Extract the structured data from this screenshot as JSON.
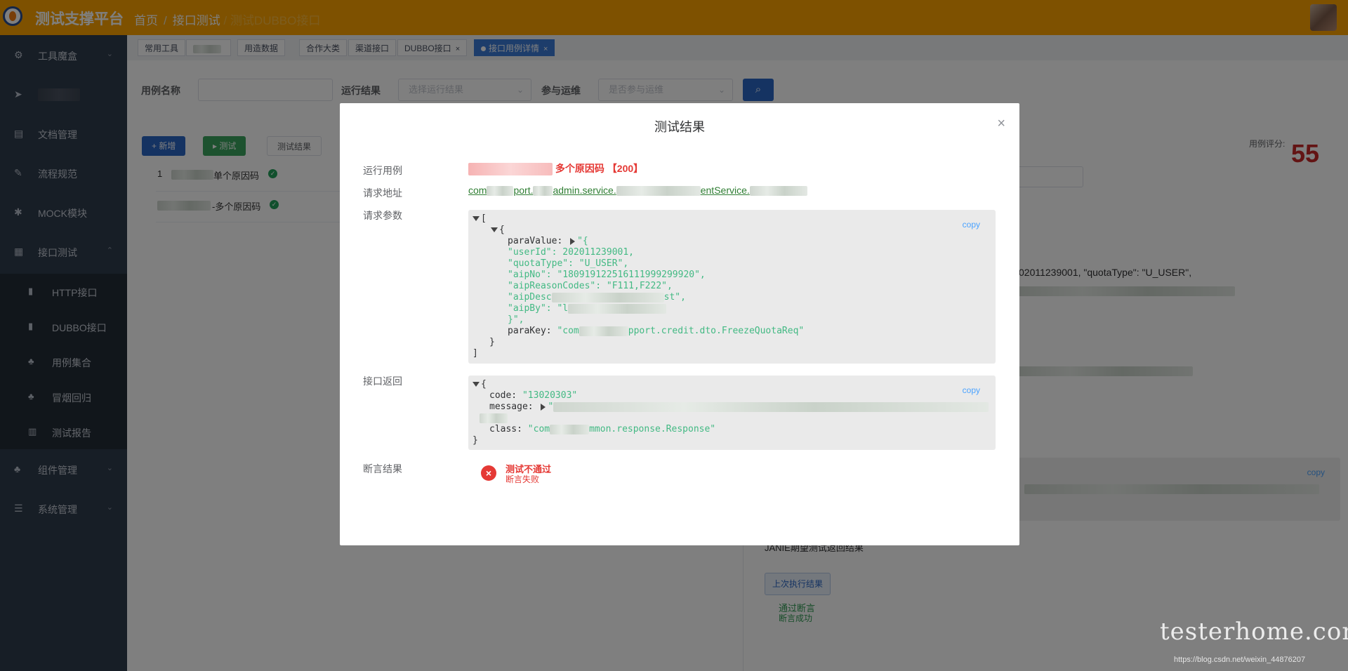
{
  "app": {
    "title": "测试支撑平台"
  },
  "breadcrumb": {
    "home": "首页",
    "section": "接口测试",
    "current": "/ 测试DUBBO接口"
  },
  "sidebar": {
    "items": [
      {
        "label": "工具魔盒",
        "icon": "gear-icon",
        "arrow": "⌄"
      },
      {
        "label": "",
        "icon": "send-icon",
        "arrow": ""
      },
      {
        "label": "文档管理",
        "icon": "document-icon",
        "arrow": ""
      },
      {
        "label": "流程规范",
        "icon": "edit-icon",
        "arrow": ""
      },
      {
        "label": "MOCK模块",
        "icon": "bug-icon",
        "arrow": ""
      },
      {
        "label": "接口测试",
        "icon": "grid-icon",
        "arrow": "⌃"
      }
    ],
    "sub_items": [
      {
        "label": "HTTP接口",
        "icon": "doc-icon"
      },
      {
        "label": "DUBBO接口",
        "icon": "doc-icon"
      },
      {
        "label": "用例集合",
        "icon": "sitemap-icon"
      },
      {
        "label": "冒烟回归",
        "icon": "sitemap-icon"
      },
      {
        "label": "测试报告",
        "icon": "bar-chart-icon"
      }
    ],
    "bottom_items": [
      {
        "label": "组件管理",
        "icon": "sitemap-icon",
        "arrow": "⌄"
      },
      {
        "label": "系统管理",
        "icon": "list-icon",
        "arrow": "⌄"
      }
    ]
  },
  "tabs": [
    {
      "label": "常用工具"
    },
    {
      "label": ""
    },
    {
      "label": "用造数据"
    },
    {
      "label": "合作大类"
    },
    {
      "label": "渠道接口"
    },
    {
      "label": "DUBBO接口",
      "close": "×"
    },
    {
      "label": "接口用例详情",
      "close": "×"
    }
  ],
  "filters": {
    "case_name_label": "用例名称",
    "run_result_label": "运行结果",
    "run_result_placeholder": "选择运行结果",
    "ops_label": "参与运维",
    "ops_placeholder": "是否参与运维"
  },
  "actions": {
    "add": "+ 新增",
    "test": "▸ 测试",
    "result": "测试结果"
  },
  "list": [
    {
      "index": "1",
      "name": "单个原因码"
    },
    {
      "index": "",
      "name": "-多个原因码"
    }
  ],
  "right_panel": {
    "score_label": "用例评分:",
    "score_value": "55",
    "param_snippet": "02011239001, \"quotaType\": \"U_USER\",",
    "copy": "copy",
    "expect_label": "JANIE期望测试返回结果",
    "last_run_btn": "上次执行结果",
    "pass_title": "通过断言",
    "pass_sub": "断言成功"
  },
  "modal": {
    "title": "测试结果",
    "close": "×",
    "run_case_label": "运行用例",
    "run_case_value": "多个原因码 【200】",
    "request_url_label": "请求地址",
    "request_url_a": "com",
    "request_url_b": "port.",
    "request_url_c": "admin.service.",
    "request_url_d": "entService.",
    "request_params_label": "请求参数",
    "response_label": "接口返回",
    "assert_label": "断言结果",
    "assert_title": "测试不通过",
    "assert_sub": "断言失败",
    "copy": "copy",
    "params_lines": {
      "l0": "[",
      "l1": "{",
      "l2_key": "paraValue: ",
      "l2_val": "\"{",
      "l3": "\"userId\": 202011239001,",
      "l4": "\"quotaType\": \"U_USER\",",
      "l5": "\"aipNo\": \"180919122516111999299920\",",
      "l6": "\"aipReasonCodes\": \"F111,F222\",",
      "l7a": "\"aipDesc",
      "l7b": "st\",",
      "l8": "\"aipBy\": \"l",
      "l9": "}\",",
      "l10_key": "paraKey: ",
      "l10_val": "\"com",
      "l10_val2": "pport.credit.dto.FreezeQuotaReq\"",
      "l11": "}",
      "l12": "]"
    },
    "response_lines": {
      "l0": "{",
      "l1_key": "code: ",
      "l1_val": "\"13020303\"",
      "l2_key": "message: ",
      "l2_val": "\"",
      "l3_key": "class: ",
      "l3_val": "\"com",
      "l3_val2": "mmon.response.Response\"",
      "l4": "}"
    }
  },
  "watermark": {
    "brand": "testerhome.com",
    "url": "https://blog.csdn.net/weixin_44876207"
  }
}
